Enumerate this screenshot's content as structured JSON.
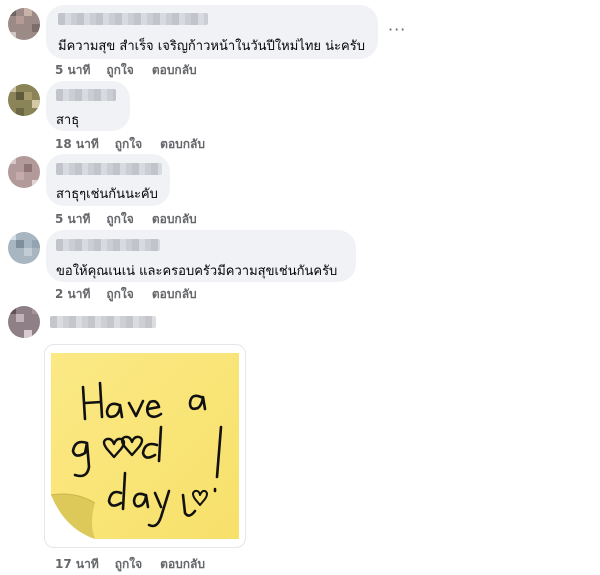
{
  "comments": [
    {
      "text": "มีความสุข สำเร็จ เจริญก้าวหน้าในวันปีใหม่ไทย น่ะครับ",
      "time": "5 นาที",
      "like": "ถูกใจ",
      "reply": "ตอบกลับ"
    },
    {
      "text": "สาธุ",
      "time": "18 นาที",
      "like": "ถูกใจ",
      "reply": "ตอบกลับ"
    },
    {
      "text": "สาธุๆเช่นกันนะคับ",
      "time": "5 นาที",
      "like": "ถูกใจ",
      "reply": "ตอบกลับ"
    },
    {
      "text": "ขอให้คุณเนเน่ และครอบครัวมีความสุขเช่นกันครับ",
      "time": "2 นาที",
      "like": "ถูกใจ",
      "reply": "ตอบกลับ"
    },
    {
      "time": "17 นาที",
      "like": "ถูกใจ",
      "reply": "ตอบกลับ"
    }
  ],
  "more_icon": "more-options-icon",
  "sticker": {
    "line1": "Have a",
    "line2_a": "g",
    "line2_b": "d",
    "line3": "day!",
    "note_color": "#fbe77c",
    "heart_icon": "heart-doodle-icon"
  }
}
